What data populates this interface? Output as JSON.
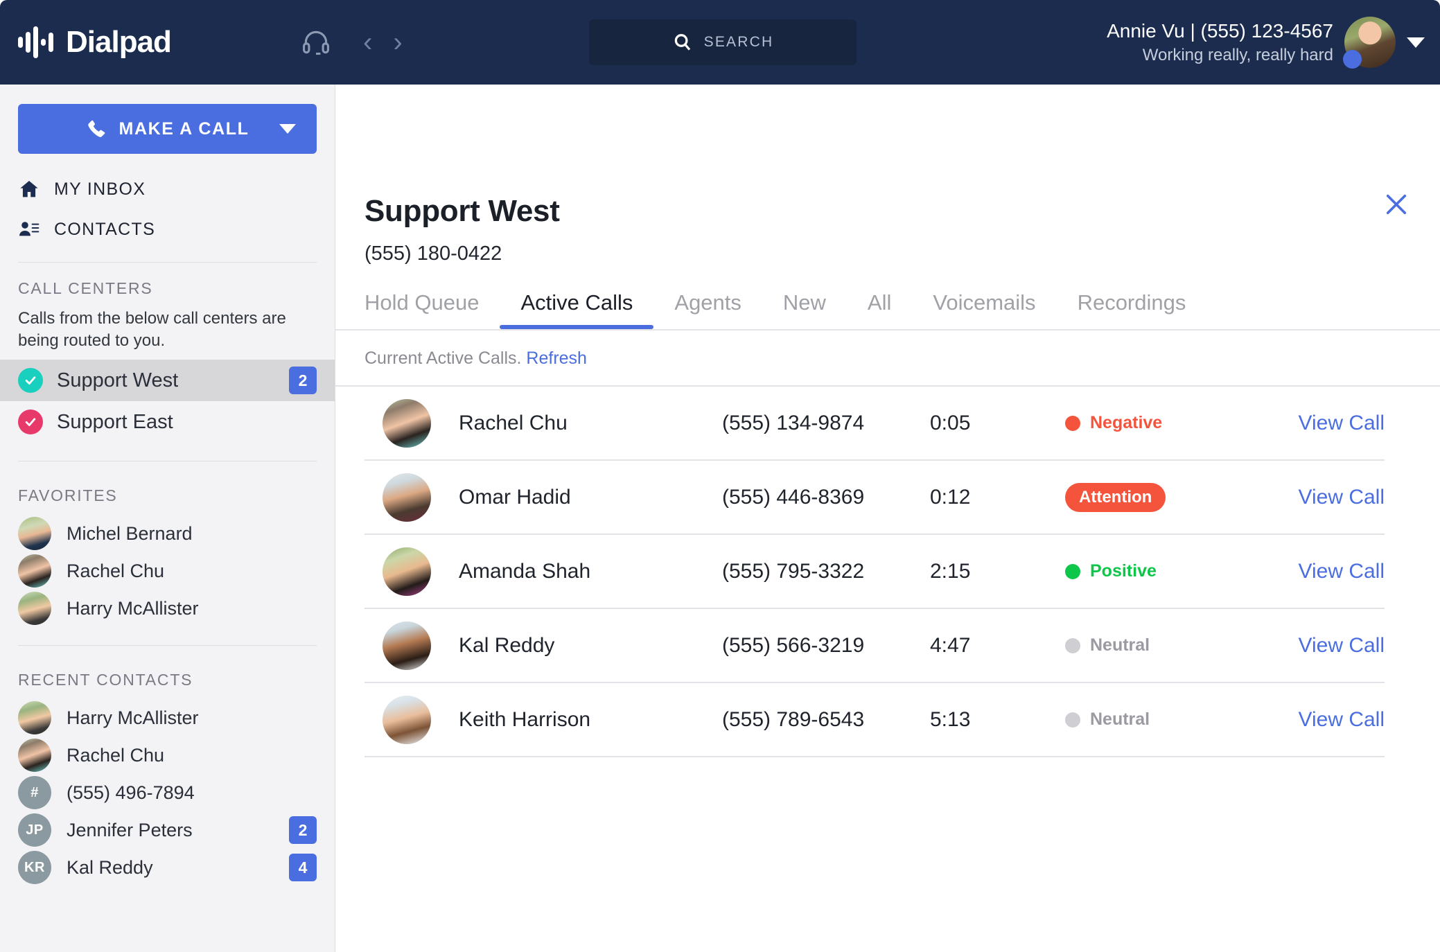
{
  "topbar": {
    "brand": "Dialpad",
    "headset_icon": "headset-icon",
    "back_icon": "chevron-left-icon",
    "forward_icon": "chevron-right-icon",
    "search_label": "SEARCH",
    "search_icon": "search-icon",
    "user_name": "Annie Vu | (555) 123-4567",
    "user_status": "Working really, really hard",
    "user_menu_icon": "caret-down-icon"
  },
  "sidebar": {
    "make_a_call": "MAKE A CALL",
    "phone_icon": "phone-icon",
    "nav": [
      {
        "label": "MY INBOX",
        "icon": "home-icon"
      },
      {
        "label": "CONTACTS",
        "icon": "contacts-icon"
      }
    ],
    "call_centers_heading": "CALL CENTERS",
    "call_centers_note": "Calls from the below call centers are being routed to you.",
    "call_centers": [
      {
        "label": "Support West",
        "badge": "2",
        "color": "#19cfbd",
        "active": true
      },
      {
        "label": "Support East",
        "badge": "",
        "color": "#e8396b",
        "active": false
      }
    ],
    "favorites_heading": "FAVORITES",
    "favorites": [
      {
        "label": "Michel Bernard",
        "avatar": "f-michel"
      },
      {
        "label": "Rachel Chu",
        "avatar": "f-rachel"
      },
      {
        "label": "Harry McAllister",
        "avatar": "f-harry"
      }
    ],
    "recent_heading": "RECENT CONTACTS",
    "recent": [
      {
        "label": "Harry McAllister",
        "avatar": "f-harry",
        "badge": ""
      },
      {
        "label": "Rachel Chu",
        "avatar": "f-rachel",
        "badge": ""
      },
      {
        "label": "(555) 496-7894",
        "initials": "#",
        "badge": ""
      },
      {
        "label": "Jennifer Peters",
        "initials": "JP",
        "badge": "2"
      },
      {
        "label": "Kal Reddy",
        "initials": "KR",
        "badge": "4"
      }
    ]
  },
  "main": {
    "close_icon": "close-icon",
    "title": "Support West",
    "phone": "(555) 180-0422",
    "tabs": [
      {
        "label": "Hold Queue",
        "active": false
      },
      {
        "label": "Active Calls",
        "active": true
      },
      {
        "label": "Agents",
        "active": false
      },
      {
        "label": "New",
        "active": false
      },
      {
        "label": "All",
        "active": false
      },
      {
        "label": "Voicemails",
        "active": false
      },
      {
        "label": "Recordings",
        "active": false
      }
    ],
    "subbar_text": "Current Active Calls.",
    "refresh_label": "Refresh",
    "calls": [
      {
        "name": "Rachel Chu",
        "phone": "(555) 134-9874",
        "duration": "0:05",
        "sentiment": "Negative",
        "style": "dot",
        "color": "#f4543c",
        "avatar": "f-rachel"
      },
      {
        "name": "Omar Hadid",
        "phone": "(555) 446-8369",
        "duration": "0:12",
        "sentiment": "Attention",
        "style": "pill",
        "color": "#f4543c",
        "avatar": "f-omar"
      },
      {
        "name": "Amanda Shah",
        "phone": "(555) 795-3322",
        "duration": "2:15",
        "sentiment": "Positive",
        "style": "dot",
        "color": "#0ec64a",
        "avatar": "f-amanda"
      },
      {
        "name": "Kal Reddy",
        "phone": "(555) 566-3219",
        "duration": "4:47",
        "sentiment": "Neutral",
        "style": "dot",
        "color": "#cfcfd3",
        "avatar": "f-kal"
      },
      {
        "name": "Keith Harrison",
        "phone": "(555) 789-6543",
        "duration": "5:13",
        "sentiment": "Neutral",
        "style": "dot",
        "color": "#cfcfd3",
        "avatar": "f-keith"
      }
    ],
    "view_call_label": "View Call"
  },
  "colors": {
    "brand_navy": "#1b2c4e",
    "accent_blue": "#4a6ee0",
    "negative": "#f4543c",
    "positive": "#0ec64a",
    "neutral": "#cfcfd3"
  }
}
